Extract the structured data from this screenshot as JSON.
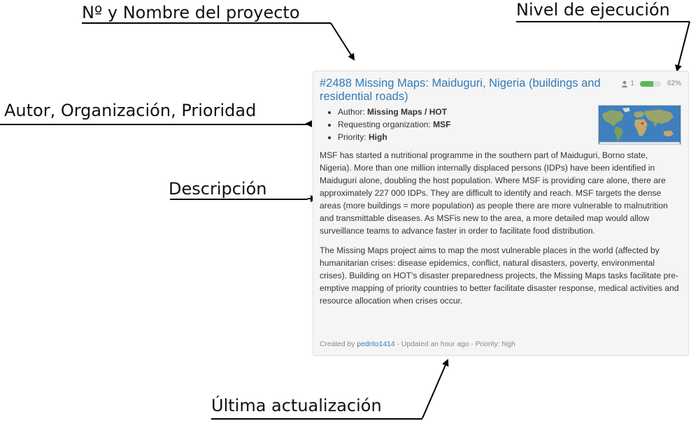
{
  "annotations": {
    "project": "Nº y Nombre del proyecto",
    "level": "Nivel de ejecución",
    "author": "Autor, Organización, Prioridad",
    "description": "Descripción",
    "update": "Última actualización"
  },
  "project": {
    "title": "#2488 Missing Maps: Maiduguri, Nigeria (buildings and residential roads)",
    "contributors": "1",
    "progress_label": "62%",
    "progress_fraction": 0.62,
    "author_label": "Author: ",
    "author_value": "Missing Maps / HOT",
    "org_label": "Requesting organization: ",
    "org_value": "MSF",
    "priority_label": "Priority: ",
    "priority_value": "High",
    "description": [
      "MSF has started a nutritional programme in the southern part of Maiduguri, Borno state, Nigeria). More than one million internally displaced persons (IDPs) have been identified in Maiduguri alone, doubling the host population. Where MSF is providing care alone, there are approximately 227 000 IDPs. They are difficult to identify and reach. MSF targets the dense areas (more buildings = more population) as people there are more vulnerable to malnutrition and transmittable diseases. As MSFis new to the area, a more detailed map would allow surveillance teams to advance faster in order to facilitate food distribution.",
      "The Missing Maps project aims to map the most vulnerable places in the world (affected by humanitarian crises: disease epidemics, conflict, natural disasters, poverty, environmental crises). Building on HOT's disaster preparedness projects, the Missing Maps tasks facilitate pre-emptive mapping of priority countries to better facilitate disaster response, medical activities and resource allocation when crises occur."
    ],
    "footer_created": "Created by ",
    "footer_user": "pedrito1414",
    "footer_rest": " - Updated an hour ago - Priority: high"
  },
  "colors": {
    "link": "#337ab7",
    "progress": "#5cb85c",
    "card_bg": "#f5f5f5"
  },
  "icons": {
    "contributors": "user-icon",
    "thumbnail": "world-map-thumbnail"
  }
}
